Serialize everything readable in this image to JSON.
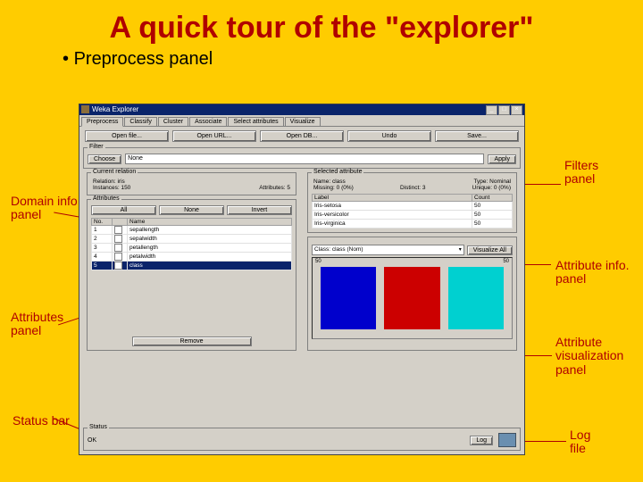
{
  "slide": {
    "title": "A quick tour of the \"explorer\"",
    "bullet": "Preprocess panel"
  },
  "annotations": {
    "filters": "Filters\npanel",
    "domain": "Domain info.\npanel",
    "attr_info": "Attribute info.\npanel",
    "attributes": "Attributes\npanel",
    "attr_viz": "Attribute\nvisualization\npanel",
    "status": "Status bar",
    "log": "Log\nfile"
  },
  "window": {
    "title": "Weka Explorer",
    "tabs": [
      "Preprocess",
      "Classify",
      "Cluster",
      "Associate",
      "Select attributes",
      "Visualize"
    ],
    "active_tab": 0,
    "toolbar": {
      "open_file": "Open file...",
      "open_url": "Open URL...",
      "open_db": "Open DB...",
      "undo": "Undo",
      "save": "Save..."
    },
    "filter": {
      "label": "Filter",
      "choose": "Choose",
      "value": "None",
      "apply": "Apply"
    },
    "relation": {
      "label": "Current relation",
      "relation_label": "Relation:",
      "relation": "iris",
      "instances_label": "Instances:",
      "instances": "150",
      "attributes_label": "Attributes:",
      "attributes": "5"
    },
    "selected_attr": {
      "label": "Selected attribute",
      "name_label": "Name:",
      "name": "class",
      "type_label": "Type:",
      "type": "Nominal",
      "missing_label": "Missing:",
      "missing": "0 (0%)",
      "distinct_label": "Distinct:",
      "distinct": "3",
      "unique_label": "Unique:",
      "unique": "0 (0%)"
    },
    "attrs": {
      "label": "Attributes",
      "btn_all": "All",
      "btn_none": "None",
      "btn_invert": "Invert",
      "col_no": "No.",
      "col_name": "Name",
      "rows": [
        {
          "no": "1",
          "name": "sepallength"
        },
        {
          "no": "2",
          "name": "sepalwidth"
        },
        {
          "no": "3",
          "name": "petallength"
        },
        {
          "no": "4",
          "name": "petalwidth"
        },
        {
          "no": "5",
          "name": "class",
          "selected": true
        }
      ],
      "remove": "Remove"
    },
    "values": {
      "col_label": "Label",
      "col_count": "Count",
      "rows": [
        {
          "label": "Iris-setosa",
          "count": "50"
        },
        {
          "label": "Iris-versicolor",
          "count": "50"
        },
        {
          "label": "Iris-virginica",
          "count": "50"
        }
      ]
    },
    "viz": {
      "class_combo": "Class: class (Nom)",
      "viz_all": "Visualize All",
      "axis_left": "50",
      "axis_right": "50"
    },
    "status": {
      "label": "Status",
      "text": "OK",
      "log": "Log",
      "win_min": "_",
      "win_max": "□",
      "win_close": "×"
    }
  }
}
